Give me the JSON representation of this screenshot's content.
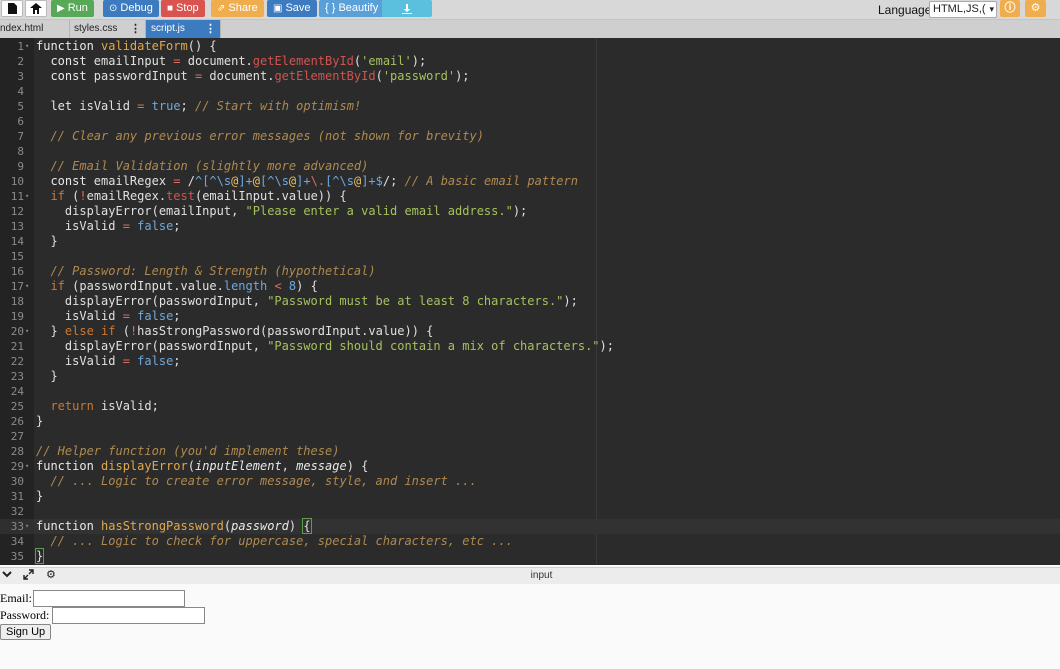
{
  "toolbar": {
    "new_icon": "file-icon",
    "fork_icon": "fork-icon",
    "run_label": "Run",
    "debug_label": "Debug",
    "stop_label": "Stop",
    "share_label": "Share",
    "save_label": "Save",
    "beautify_label": "{ } Beautify",
    "download_icon": "download-icon",
    "language_label": "Language",
    "language_value": "HTML,JS,(",
    "info_icon": "info-icon",
    "settings_icon": "gear-icon"
  },
  "tabs": [
    {
      "label": "ndex.html"
    },
    {
      "label": "styles.css"
    },
    {
      "label": "script.js",
      "active": true
    }
  ],
  "editor": {
    "active_line": 33,
    "lines": [
      {
        "n": 1,
        "fold": true,
        "html": "<span class=\"t-k\">function</span> <span class=\"t-f\">validateForm</span>() {"
      },
      {
        "n": 2,
        "html": "  <span class=\"t-k\">const</span> emailInput <span class=\"t-o\">=</span> document.<span class=\"t-m\">getElementById</span>(<span class=\"t-s\">'email'</span>);"
      },
      {
        "n": 3,
        "html": "  <span class=\"t-k\">const</span> passwordInput <span class=\"t-o\">=</span> document.<span class=\"t-m\">getElementById</span>(<span class=\"t-s\">'password'</span>);"
      },
      {
        "n": 4,
        "html": ""
      },
      {
        "n": 5,
        "html": "  <span class=\"t-k\">let</span> isValid <span class=\"t-o\">=</span> <span class=\"t-n\">true</span>; <span class=\"t-c\">// Start with optimism!</span>"
      },
      {
        "n": 6,
        "html": ""
      },
      {
        "n": 7,
        "html": "  <span class=\"t-c\">// Clear any previous error messages (not shown for brevity)</span>"
      },
      {
        "n": 8,
        "html": ""
      },
      {
        "n": 9,
        "html": "  <span class=\"t-c\">// Email Validation (slightly more advanced)</span>"
      },
      {
        "n": 10,
        "html": "  <span class=\"t-k\">const</span> emailRegex <span class=\"t-o\">=</span> /<span class=\"t-r1\">^[^\\s</span><span class=\"t-r2\">@</span><span class=\"t-r1\">]+</span><span class=\"t-r2\">@</span><span class=\"t-r1\">[^\\s</span><span class=\"t-r2\">@</span><span class=\"t-r1\">]+</span><span class=\"t-o\">\\.</span><span class=\"t-r1\">[^\\s</span><span class=\"t-r2\">@</span><span class=\"t-r1\">]+$</span>/; <span class=\"t-c\">// A basic email pattern</span>"
      },
      {
        "n": 11,
        "fold": true,
        "html": "  <span class=\"t-ctrl\">if</span> (<span class=\"t-o\">!</span>emailRegex.<span class=\"t-m\">test</span>(emailInput.value)) {"
      },
      {
        "n": 12,
        "html": "    displayError(emailInput, <span class=\"t-s\">\"Please enter a valid email address.\"</span>);"
      },
      {
        "n": 13,
        "html": "    isValid <span class=\"t-o\">=</span> <span class=\"t-n\">false</span>;"
      },
      {
        "n": 14,
        "html": "  }"
      },
      {
        "n": 15,
        "html": ""
      },
      {
        "n": 16,
        "html": "  <span class=\"t-c\">// Password: Length &amp; Strength (hypothetical)</span>"
      },
      {
        "n": 17,
        "fold": true,
        "html": "  <span class=\"t-ctrl\">if</span> (passwordInput.value.<span class=\"t-n\">length</span> <span class=\"t-o\">&lt;</span> <span class=\"t-n\">8</span>) {"
      },
      {
        "n": 18,
        "html": "    displayError(passwordInput, <span class=\"t-s\">\"Password must be at least 8 characters.\"</span>);"
      },
      {
        "n": 19,
        "html": "    isValid <span class=\"t-o\">=</span> <span class=\"t-n\">false</span>;"
      },
      {
        "n": 20,
        "fold": true,
        "html": "  } <span class=\"t-ctrl\">else if</span> (<span class=\"t-o\">!</span>hasStrongPassword(passwordInput.value)) {"
      },
      {
        "n": 21,
        "html": "    displayError(passwordInput, <span class=\"t-s\">\"Password should contain a mix of characters.\"</span>);"
      },
      {
        "n": 22,
        "html": "    isValid <span class=\"t-o\">=</span> <span class=\"t-n\">false</span>;"
      },
      {
        "n": 23,
        "html": "  }"
      },
      {
        "n": 24,
        "html": ""
      },
      {
        "n": 25,
        "html": "  <span class=\"t-ctrl\">return</span> isValid;"
      },
      {
        "n": 26,
        "html": "}"
      },
      {
        "n": 27,
        "html": ""
      },
      {
        "n": 28,
        "html": "<span class=\"t-c\">// Helper function (you'd implement these)</span>"
      },
      {
        "n": 29,
        "fold": true,
        "html": "<span class=\"t-k\">function</span> <span class=\"t-f\">displayError</span>(<span class=\"t-p\">inputElement</span>, <span class=\"t-p\">message</span>) {"
      },
      {
        "n": 30,
        "html": "  <span class=\"t-c\">// ... Logic to create error message, style, and insert ...</span>"
      },
      {
        "n": 31,
        "html": "}"
      },
      {
        "n": 32,
        "html": ""
      },
      {
        "n": 33,
        "fold": true,
        "html": "<span class=\"t-k\">function</span> <span class=\"t-f\">hasStrongPassword</span>(<span class=\"t-p\">password</span>) <span class=\"bracket-box\">{</span>"
      },
      {
        "n": 34,
        "html": "  <span class=\"t-c\">// ... Logic to check for uppercase, special characters, etc ...</span>"
      },
      {
        "n": 35,
        "html": "<span class=\"bracket-box\">}</span>"
      }
    ]
  },
  "output": {
    "title": "input",
    "collapse_icon": "chevron-down-icon",
    "expand_icon": "expand-icon",
    "settings_icon": "gear-icon",
    "email_label": "Email:",
    "email_value": "",
    "password_label": "Password:",
    "password_value": "",
    "submit_label": "Sign Up"
  }
}
